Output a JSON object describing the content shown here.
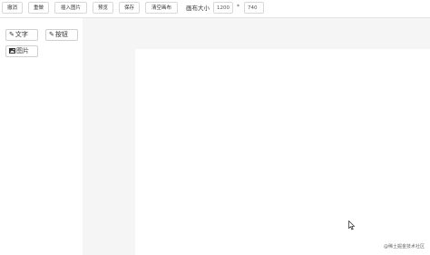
{
  "toolbar": {
    "undo_label": "撤消",
    "redo_label": "重做",
    "insert_image_label": "插入图片",
    "preview_label": "预览",
    "save_label": "保存",
    "clear_canvas_label": "清空画布",
    "canvas_size_label": "画布大小",
    "width_value": "1200",
    "times_symbol": "*",
    "height_value": "740"
  },
  "tools": {
    "text_label": "文字",
    "button_label": "按钮",
    "image_label": "图片"
  },
  "icons": {
    "text_icon": "pencil-icon",
    "button_icon": "pencil-icon",
    "image_icon": "image-icon"
  },
  "watermark": "@稀土掘金技术社区",
  "colors": {
    "workspace_bg": "#f5f5f5",
    "canvas_bg": "#ffffff",
    "border": "#d9d9d9"
  }
}
